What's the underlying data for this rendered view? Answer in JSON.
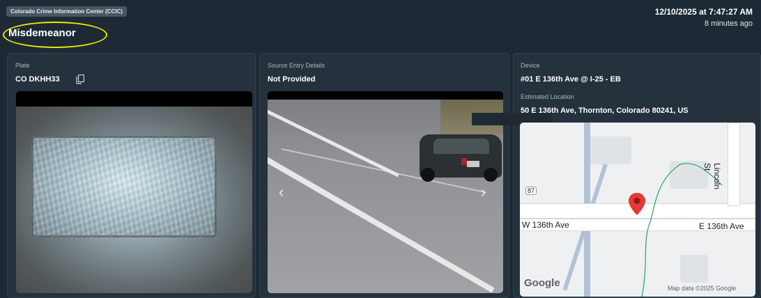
{
  "header": {
    "source_badge": "Colorado Crime Information Center (CCIC)",
    "category": "Misdemeanor",
    "timestamp": "12/10/2025 at 7:47:27 AM",
    "relative_time": "8 minutes ago"
  },
  "plate_card": {
    "label": "Plate",
    "value": "CO DKHH33",
    "copy_icon": "copy-icon"
  },
  "source_card": {
    "label": "Source Entry Details",
    "value": "Not Provided",
    "prev_arrow": "‹",
    "next_arrow": "›"
  },
  "device_card": {
    "label": "Device",
    "value": "#01 E 136th Ave @ I-25 - EB",
    "location_label": "Estimated Location",
    "location_value": "50 E 136th Ave, Thornton, Colorado 80241, US"
  },
  "map": {
    "street_west": "W 136th Ave",
    "street_east": "E 136th Ave",
    "street_north": "Lincoln St",
    "route_shield": "87",
    "google": "Google",
    "attribution": "Map data ©2025 Google"
  },
  "colors": {
    "background": "#1d2a36",
    "card": "#25323e",
    "highlight": "#f1e600",
    "pin": "#e53935"
  }
}
